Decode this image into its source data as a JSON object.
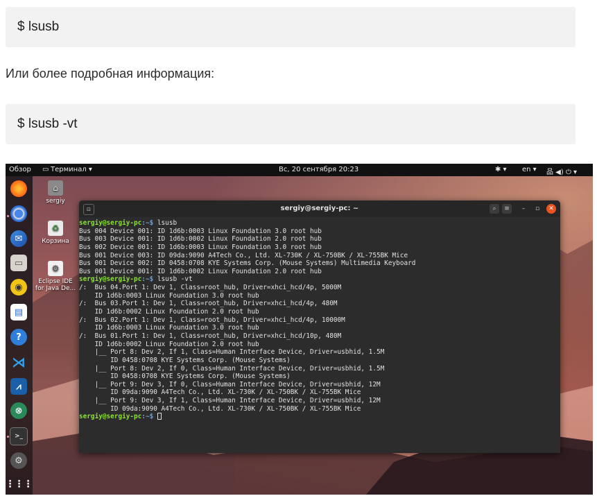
{
  "article": {
    "code1": "$  lsusb",
    "paragraph": "Или более подробная информация:",
    "code2": "$  lsusb -vt"
  },
  "topbar": {
    "overview": "Обзор",
    "app_menu": "Терминал ▾",
    "clock": "Вс, 20 сентября  20:23",
    "accessibility": "✱ ▾",
    "language": "en ▾",
    "system": "品 ◀) ⏻ ▾"
  },
  "desktop_icons": [
    {
      "label": "sergiy"
    },
    {
      "label": "Корзина"
    },
    {
      "label": "Eclipse IDE for Java De..."
    }
  ],
  "terminal": {
    "title": "sergiy@sergiy-pc: ~",
    "prompt_user": "sergiy@sergiy-pc",
    "prompt_path": ":~$",
    "cmd1": " lsusb",
    "cmd2": " lsusb -vt",
    "lsusb_output": [
      "Bus 004 Device 001: ID 1d6b:0003 Linux Foundation 3.0 root hub",
      "Bus 003 Device 001: ID 1d6b:0002 Linux Foundation 2.0 root hub",
      "Bus 002 Device 001: ID 1d6b:0003 Linux Foundation 3.0 root hub",
      "Bus 001 Device 003: ID 09da:9090 A4Tech Co., Ltd. XL-730K / XL-750BK / XL-755BK Mice",
      "Bus 001 Device 002: ID 0458:0708 KYE Systems Corp. (Mouse Systems) Multimedia Keyboard",
      "Bus 001 Device 001: ID 1d6b:0002 Linux Foundation 2.0 root hub"
    ],
    "tree_output": [
      "/:  Bus 04.Port 1: Dev 1, Class=root_hub, Driver=xhci_hcd/4p, 5000M",
      "    ID 1d6b:0003 Linux Foundation 3.0 root hub",
      "/:  Bus 03.Port 1: Dev 1, Class=root_hub, Driver=xhci_hcd/4p, 480M",
      "    ID 1d6b:0002 Linux Foundation 2.0 root hub",
      "/:  Bus 02.Port 1: Dev 1, Class=root_hub, Driver=xhci_hcd/4p, 10000M",
      "    ID 1d6b:0003 Linux Foundation 3.0 root hub",
      "/:  Bus 01.Port 1: Dev 1, Class=root_hub, Driver=xhci_hcd/10p, 480M",
      "    ID 1d6b:0002 Linux Foundation 2.0 root hub",
      "    |__ Port 8: Dev 2, If 1, Class=Human Interface Device, Driver=usbhid, 1.5M",
      "        ID 0458:0708 KYE Systems Corp. (Mouse Systems)",
      "    |__ Port 8: Dev 2, If 0, Class=Human Interface Device, Driver=usbhid, 1.5M",
      "        ID 0458:0708 KYE Systems Corp. (Mouse Systems)",
      "    |__ Port 9: Dev 3, If 0, Class=Human Interface Device, Driver=usbhid, 12M",
      "        ID 09da:9090 A4Tech Co., Ltd. XL-730K / XL-750BK / XL-755BK Mice",
      "    |__ Port 9: Dev 3, If 1, Class=Human Interface Device, Driver=usbhid, 12M",
      "        ID 09da:9090 A4Tech Co., Ltd. XL-730K / XL-750BK / XL-755BK Mice"
    ]
  },
  "dock_icons": [
    "firefox-icon",
    "chromium-icon",
    "thunderbird-icon",
    "files-icon",
    "rhythmbox-icon",
    "libreoffice-writer-icon",
    "help-icon",
    "vscode-icon",
    "system-monitor-icon",
    "crossover-icon",
    "terminal-icon",
    "settings-icon",
    "show-apps-icon"
  ],
  "colors": {
    "prompt_user": "#8ae234",
    "prompt_path": "#729fcf",
    "terminal_bg": "#2c2c2c",
    "code_bg": "#f2f2f2"
  }
}
